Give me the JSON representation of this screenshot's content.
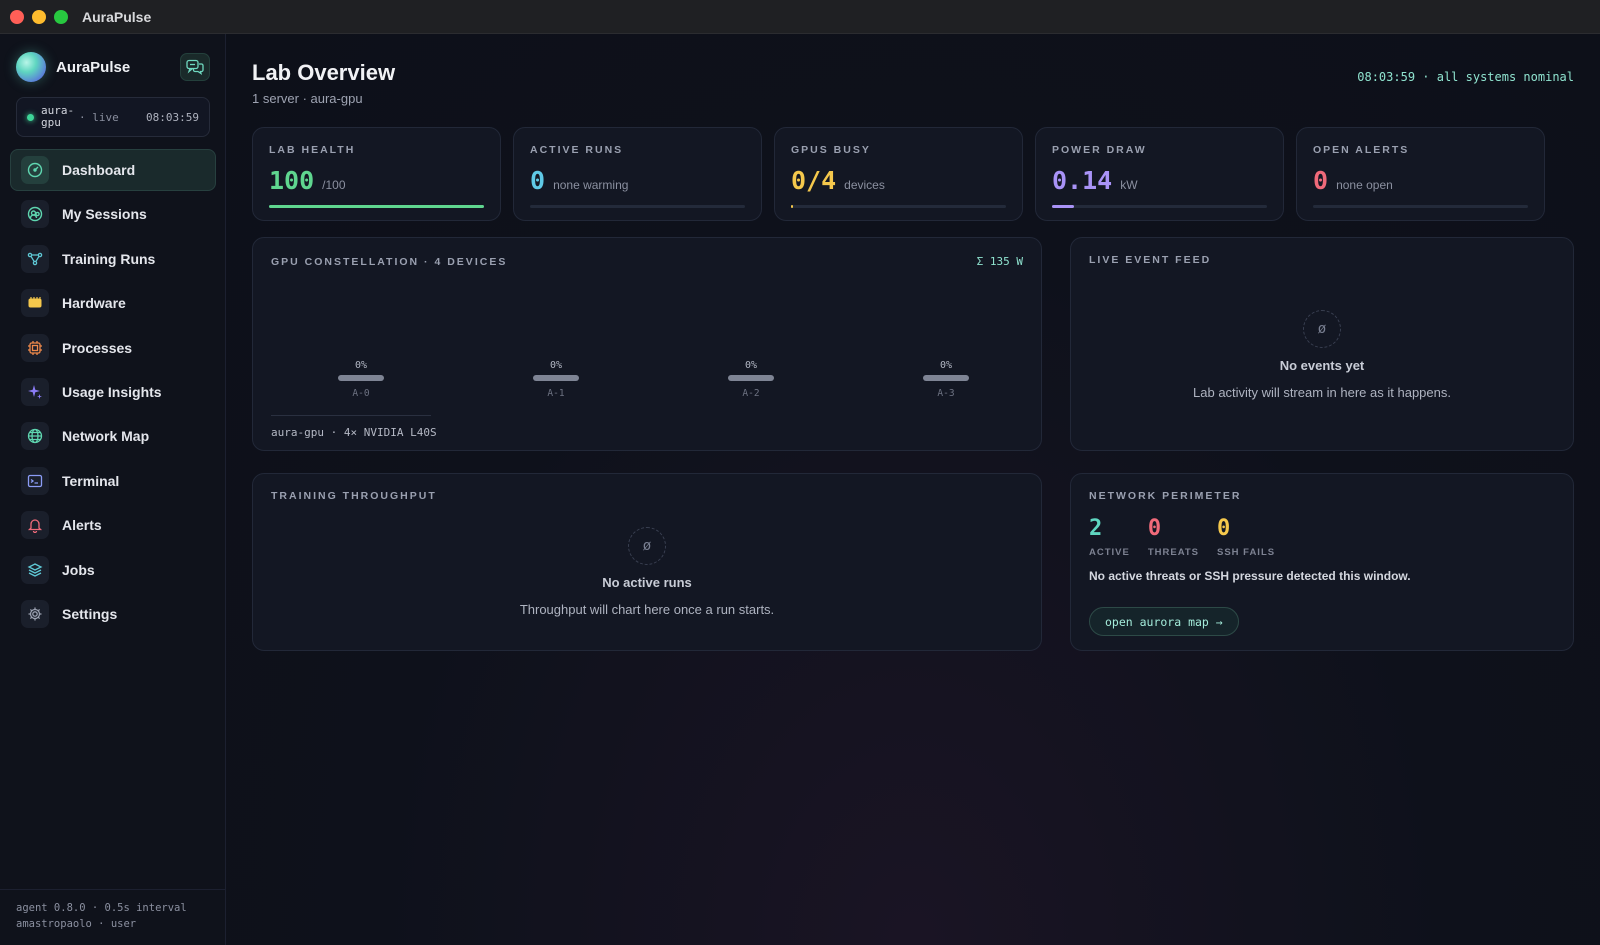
{
  "window": {
    "title": "AuraPulse"
  },
  "brand": {
    "name": "AuraPulse"
  },
  "server": {
    "name": "aura-gpu",
    "status": "· live",
    "time": "08:03:59"
  },
  "nav": [
    {
      "label": "Dashboard",
      "icon": "gauge-icon",
      "color": "#5fd6b0"
    },
    {
      "label": "My Sessions",
      "icon": "users-icon",
      "color": "#5fd6b0"
    },
    {
      "label": "Training Runs",
      "icon": "graph-icon",
      "color": "#5fc9d6"
    },
    {
      "label": "Hardware",
      "icon": "chip-icon",
      "color": "#f5c84c"
    },
    {
      "label": "Processes",
      "icon": "cpu-icon",
      "color": "#f08a4b"
    },
    {
      "label": "Usage Insights",
      "icon": "sparkle-icon",
      "color": "#8b7cf6"
    },
    {
      "label": "Network Map",
      "icon": "globe-icon",
      "color": "#5fd6b0"
    },
    {
      "label": "Terminal",
      "icon": "terminal-icon",
      "color": "#8b9cf6"
    },
    {
      "label": "Alerts",
      "icon": "bell-icon",
      "color": "#f06a7a"
    },
    {
      "label": "Jobs",
      "icon": "layers-icon",
      "color": "#5fc9d6"
    },
    {
      "label": "Settings",
      "icon": "gear-icon",
      "color": "#9aa0b0"
    }
  ],
  "footer": {
    "line1": "agent 0.8.0 · 0.5s interval",
    "line2": "amastropaolo · user"
  },
  "header": {
    "title": "Lab Overview",
    "subtitle": "1 server · aura-gpu",
    "status": "08:03:59 · all systems nominal"
  },
  "kpis": [
    {
      "caption": "LAB HEALTH",
      "value": "100",
      "unit": "/100",
      "color": "#5fd68f",
      "fill_fraction": 1.0,
      "fill_color": "#5fd68f"
    },
    {
      "caption": "ACTIVE RUNS",
      "value": "0",
      "unit": "none warming",
      "color": "#5fc9e6",
      "fill_fraction": 0.0,
      "fill_color": "#5fc9e6"
    },
    {
      "caption": "GPUS BUSY",
      "value": "0/4",
      "unit": "devices",
      "color": "#f5c84c",
      "fill_fraction": 0.01,
      "fill_color": "#f5c84c"
    },
    {
      "caption": "POWER DRAW",
      "value": "0.14",
      "unit": "kW",
      "color": "#a993f7",
      "fill_fraction": 0.1,
      "fill_color": "#a993f7"
    },
    {
      "caption": "OPEN ALERTS",
      "value": "0",
      "unit": "none open",
      "color": "#f06a7a",
      "fill_fraction": 0.0,
      "fill_color": "#f06a7a"
    }
  ],
  "gpu": {
    "caption": "GPU CONSTELLATION · 4 DEVICES",
    "sum": "Σ 135 W",
    "devices": [
      {
        "label": "A-0",
        "util": "0%"
      },
      {
        "label": "A-1",
        "util": "0%"
      },
      {
        "label": "A-2",
        "util": "0%"
      },
      {
        "label": "A-3",
        "util": "0%"
      }
    ],
    "footer": "aura-gpu · 4× NVIDIA L40S"
  },
  "events": {
    "caption": "LIVE EVENT FEED",
    "icon": "empty-set-icon",
    "icon_glyph": "ø",
    "title": "No events yet",
    "desc": "Lab activity will stream in here as it happens."
  },
  "throughput": {
    "caption": "TRAINING THROUGHPUT",
    "icon_glyph": "ø",
    "title": "No active runs",
    "desc": "Throughput will chart here once a run starts."
  },
  "network": {
    "caption": "NETWORK PERIMETER",
    "stats": [
      {
        "value": "2",
        "label": "ACTIVE",
        "color": "#5fd6c0"
      },
      {
        "value": "0",
        "label": "THREATS",
        "color": "#f06a7a"
      },
      {
        "value": "0",
        "label": "SSH FAILS",
        "color": "#f5c84c"
      }
    ],
    "message": "No active threats or SSH pressure detected this window.",
    "button": "open aurora map →"
  }
}
